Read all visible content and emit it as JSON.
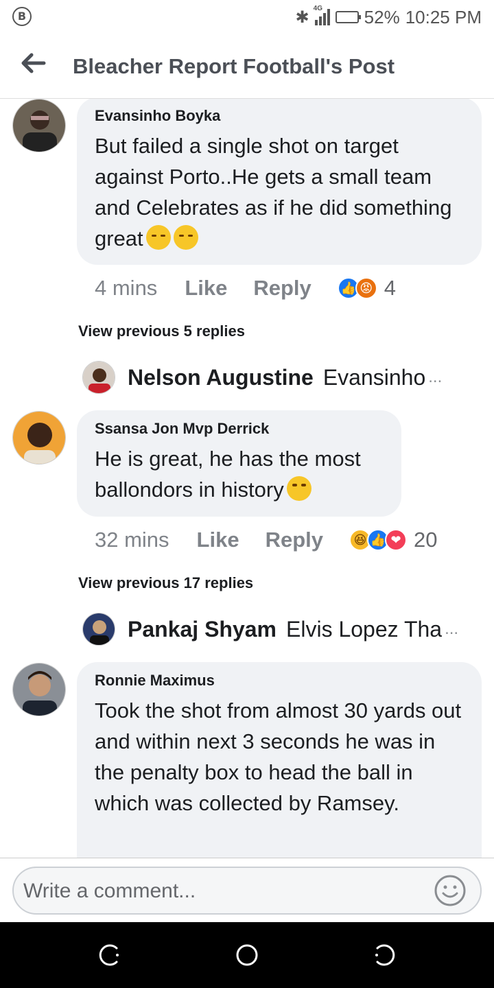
{
  "status": {
    "time": "10:25 PM",
    "battery_percent": "52%",
    "network": "4G",
    "battery_level": 0.52,
    "left_icon_letter": "B"
  },
  "header": {
    "title": "Bleacher Report Football's Post"
  },
  "comments": [
    {
      "author": "Evansinho Boyka",
      "text": "But failed a single shot on target against Porto..He gets a small team and Celebrates as if he did something great",
      "time": "4 mins",
      "like": "Like",
      "reply": "Reply",
      "reactions": [
        "like",
        "angry"
      ],
      "reaction_count": "4",
      "view_previous": "View previous 5 replies",
      "latest_reply": {
        "author": "Nelson Augustine",
        "text": "Evansinho",
        "ellipsis": "..."
      }
    },
    {
      "author": "Ssansa Jon Mvp Derrick",
      "text": "He is great, he has the most ballondors in history",
      "time": "32 mins",
      "like": "Like",
      "reply": "Reply",
      "reactions": [
        "haha",
        "like",
        "love"
      ],
      "reaction_count": "20",
      "view_previous": "View previous 17 replies",
      "latest_reply": {
        "author": "Pankaj Shyam",
        "text": "Elvis Lopez Tha",
        "ellipsis": "..."
      }
    },
    {
      "author": "Ronnie Maximus",
      "text": "Took the shot from almost 30 yards out and within next 3 seconds he was in the penalty box to head the ball in which was collected by Ramsey."
    }
  ],
  "composer": {
    "placeholder": "Write a comment..."
  },
  "colors": {
    "bubble": "#f0f2f5",
    "like_blue": "#1877f2",
    "meta_gray": "#7f8389"
  }
}
